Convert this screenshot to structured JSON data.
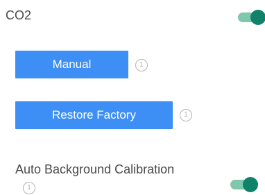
{
  "co2": {
    "title": "CO2",
    "toggle_on": true
  },
  "buttons": {
    "manual_label": "Manual",
    "restore_label": "Restore Factory"
  },
  "info_icon_glyph": "1",
  "auto_background_calibration": {
    "label": "Auto Background Calibration",
    "toggle_on": true
  },
  "colors": {
    "button_blue": "#3d8ff5",
    "toggle_track": "#7fc7ad",
    "toggle_knob": "#10826a",
    "text": "#4a4a4a",
    "icon_gray": "#b5b5b5"
  },
  "icons": {
    "info": "info-circle-icon"
  }
}
